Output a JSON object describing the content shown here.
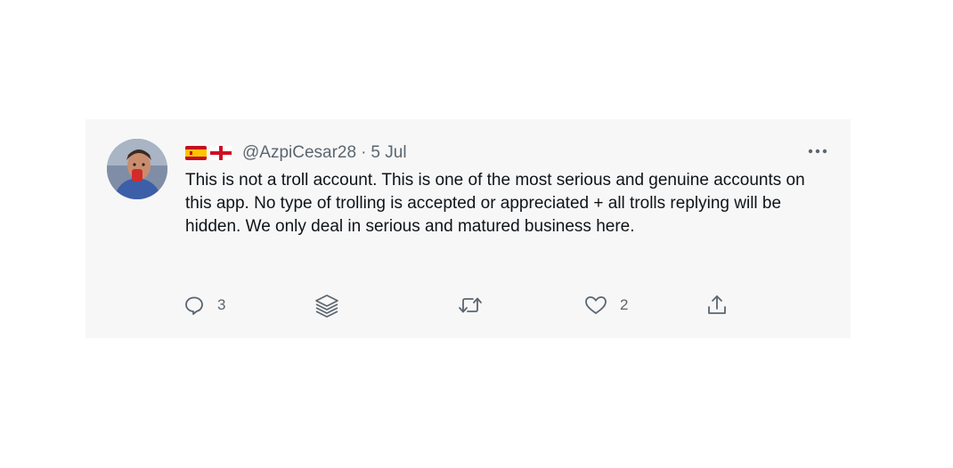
{
  "tweet": {
    "flags": [
      "spain-flag",
      "england-flag"
    ],
    "handle": "@AzpiCesar28",
    "separator": "·",
    "date": "5 Jul",
    "text": "This is not a troll account. This is one of the most serious and genuine accounts on this app. No type of trolling is accepted or appreciated + all trolls replying will be hidden. We only deal in serious and matured business here.",
    "actions": {
      "reply": {
        "icon": "reply-icon",
        "count": "3"
      },
      "layers": {
        "icon": "layers-icon"
      },
      "retweet": {
        "icon": "retweet-icon"
      },
      "like": {
        "icon": "heart-icon",
        "count": "2"
      },
      "share": {
        "icon": "share-icon"
      }
    },
    "more_icon": "more-icon"
  },
  "colors": {
    "card_background": "#f7f7f7",
    "text_primary": "#0f1419",
    "text_secondary": "#5b6670"
  }
}
